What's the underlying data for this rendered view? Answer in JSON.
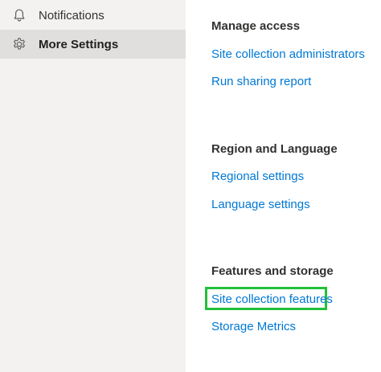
{
  "sidebar": {
    "items": [
      {
        "label": "Notifications",
        "icon": "bell-icon"
      },
      {
        "label": "More Settings",
        "icon": "gear-icon",
        "selected": true
      }
    ]
  },
  "main": {
    "sections": [
      {
        "title": "Manage access",
        "links": [
          "Site collection administrators",
          "Run sharing report"
        ]
      },
      {
        "title": "Region and Language",
        "links": [
          "Regional settings",
          "Language settings"
        ]
      },
      {
        "title": "Features and storage",
        "links": [
          "Site collection features",
          "Storage Metrics"
        ]
      }
    ]
  },
  "colors": {
    "sidebar_bg": "#f3f2f1",
    "selected_bg": "#e1dfdd",
    "link": "#0078d4",
    "highlight": "#22c03a"
  }
}
